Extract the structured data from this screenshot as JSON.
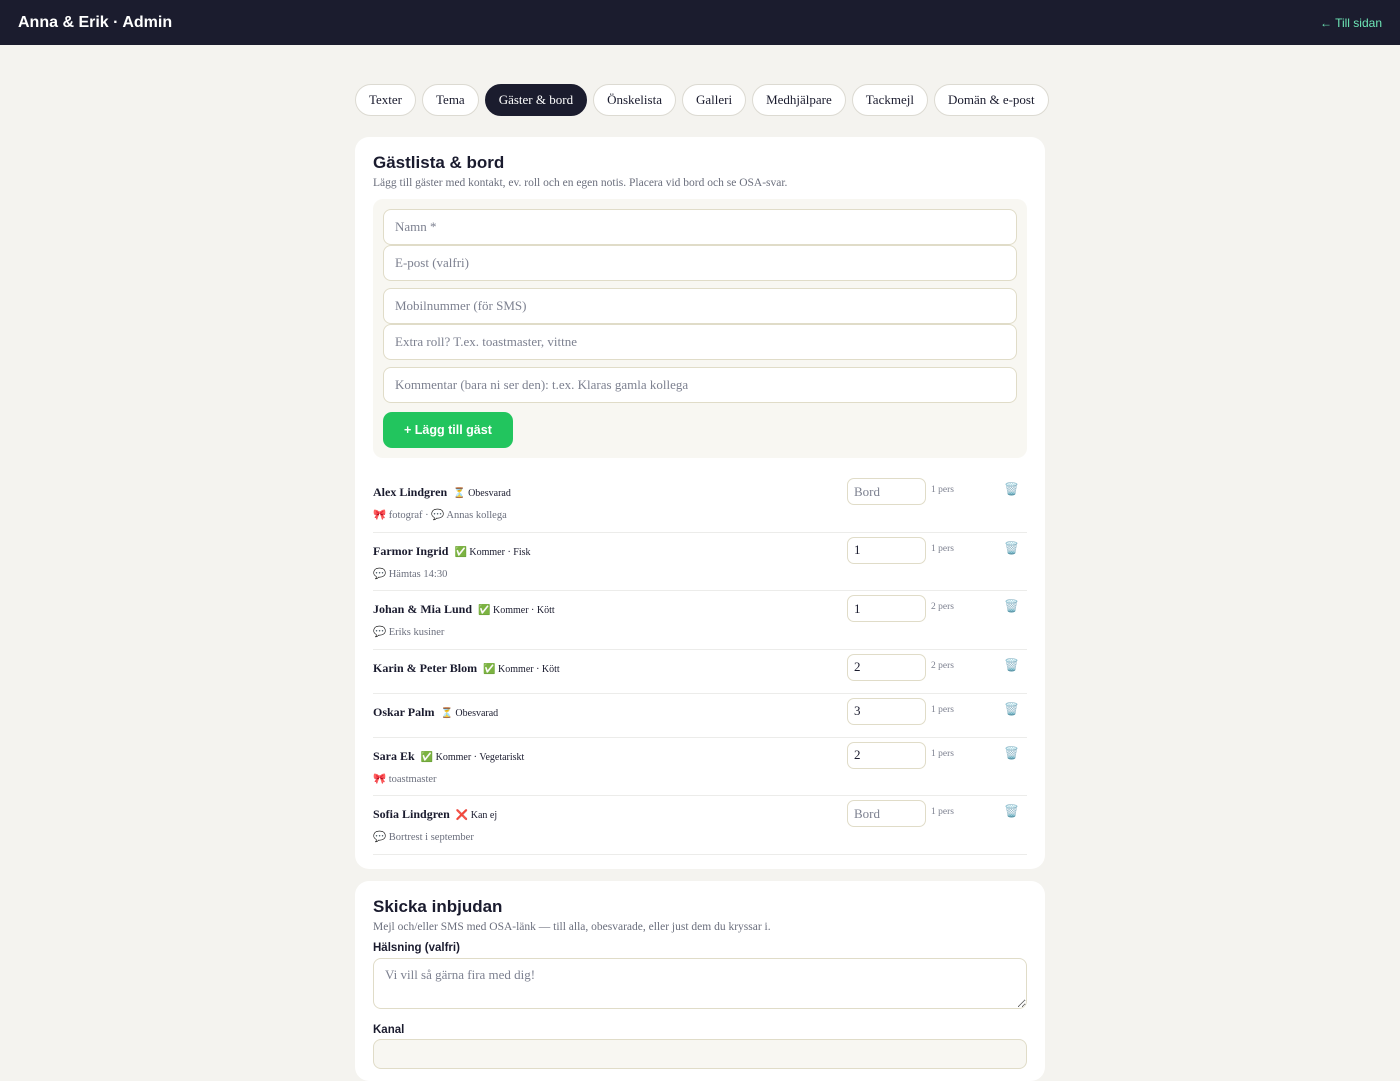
{
  "header": {
    "title": "Anna & Erik · Admin",
    "back_link": "← Till sidan"
  },
  "tabs": [
    {
      "label": "Texter",
      "active": false
    },
    {
      "label": "Tema",
      "active": false
    },
    {
      "label": "Gäster & bord",
      "active": true
    },
    {
      "label": "Önskelista",
      "active": false
    },
    {
      "label": "Galleri",
      "active": false
    },
    {
      "label": "Medhjälpare",
      "active": false
    },
    {
      "label": "Tackmejl",
      "active": false
    },
    {
      "label": "Domän & e-post",
      "active": false
    }
  ],
  "guestlist": {
    "title": "Gästlista & bord",
    "description": "Lägg till gäster med kontakt, ev. roll och en egen notis. Placera vid bord och se OSA-svar.",
    "form": {
      "name_placeholder": "Namn *",
      "email_placeholder": "E-post (valfri)",
      "phone_placeholder": "Mobilnummer (för SMS)",
      "role_placeholder": "Extra roll? T.ex. toastmaster, vittne",
      "comment_placeholder": "Kommentar (bara ni ser den): t.ex. Klaras gamla kollega",
      "add_button": "+ Lägg till gäst"
    },
    "table_placeholder": "Bord",
    "guests": [
      {
        "name": "Alex Lindgren",
        "status": "⏳ Obesvarad",
        "details": "🎀 fotograf · 💬 Annas kollega",
        "table": "",
        "persons": "1 pers"
      },
      {
        "name": "Farmor Ingrid",
        "status": "✅ Kommer · Fisk",
        "details": "💬 Hämtas 14:30",
        "table": "1",
        "persons": "1 pers"
      },
      {
        "name": "Johan & Mia Lund",
        "status": "✅ Kommer · Kött",
        "details": "💬 Eriks kusiner",
        "table": "1",
        "persons": "2 pers"
      },
      {
        "name": "Karin & Peter Blom",
        "status": "✅ Kommer · Kött",
        "details": "",
        "table": "2",
        "persons": "2 pers"
      },
      {
        "name": "Oskar Palm",
        "status": "⏳ Obesvarad",
        "details": "",
        "table": "3",
        "persons": "1 pers"
      },
      {
        "name": "Sara Ek",
        "status": "✅ Kommer · Vegetariskt",
        "details": "🎀 toastmaster",
        "table": "2",
        "persons": "1 pers"
      },
      {
        "name": "Sofia Lindgren",
        "status": "❌ Kan ej",
        "details": "💬 Bortrest i september",
        "table": "",
        "persons": "1 pers"
      }
    ],
    "delete_icon": "🗑️"
  },
  "invites": {
    "title": "Skicka inbjudan",
    "description": "Mejl och/eller SMS med OSA-länk — till alla, obesvarade, eller just dem du kryssar i.",
    "greeting_label": "Hälsning (valfri)",
    "greeting_placeholder": "Vi vill så gärna fira med dig!",
    "channel_label": "Kanal"
  },
  "colors": {
    "header_bg": "#1b1c2e",
    "accent_green": "#22c55e",
    "back_link": "#6ee7b7",
    "page_bg": "#f4f3ef"
  }
}
